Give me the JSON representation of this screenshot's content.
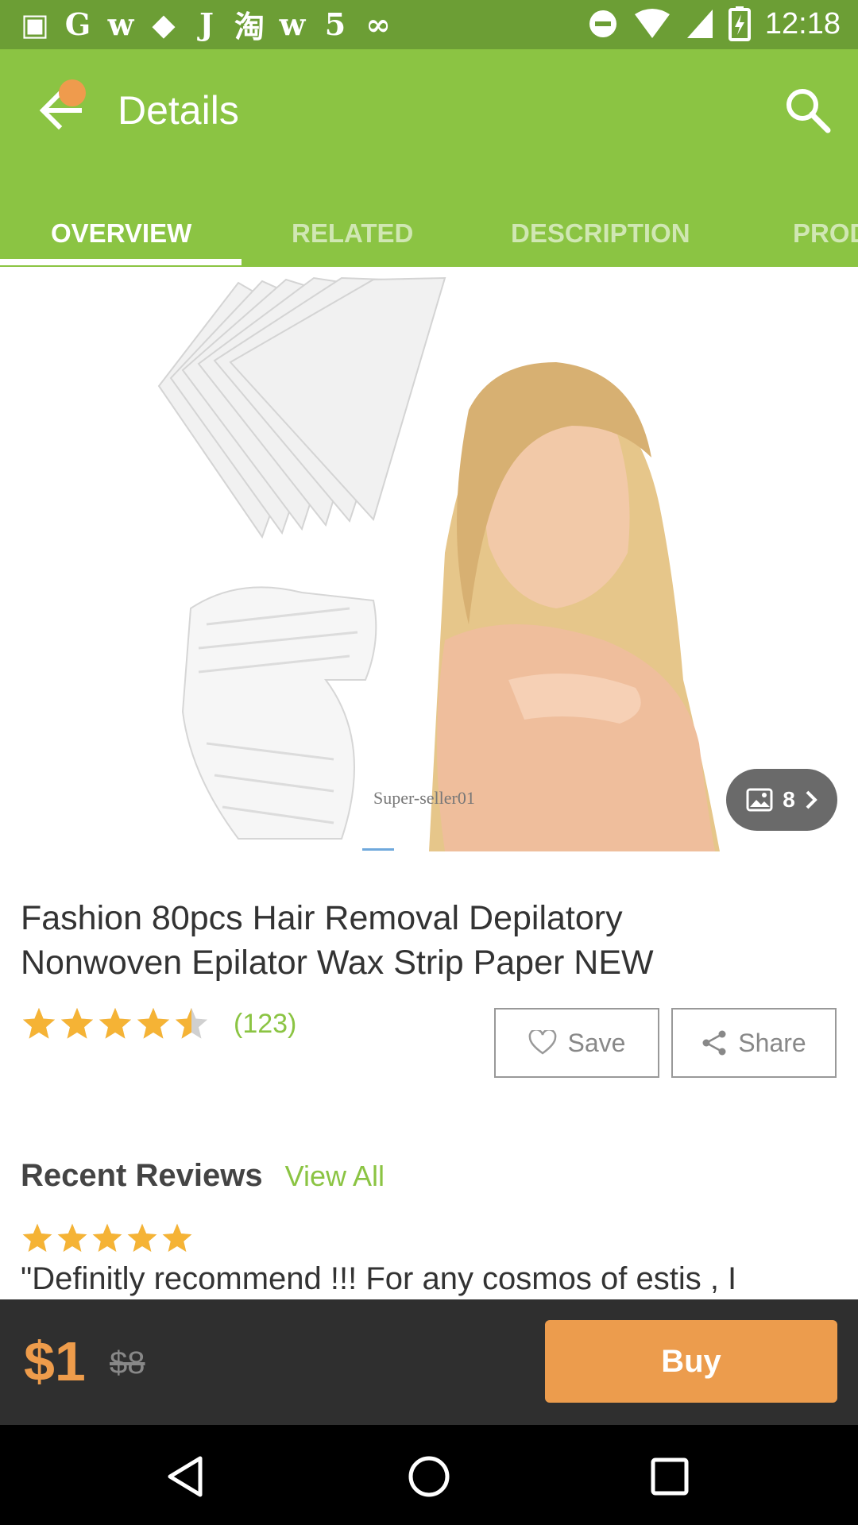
{
  "status_bar": {
    "notification_icons": [
      "shopping-bag-icon",
      "google-g-icon",
      "wish-icon",
      "gift-icon",
      "j-app-icon",
      "taobao-icon",
      "wish-icon",
      "tab-5-icon",
      "link-icon"
    ],
    "notification_glyphs": [
      "▣",
      "G",
      "w",
      "◆",
      "J",
      "淘",
      "w",
      "5",
      "∞"
    ],
    "time": "12:18"
  },
  "app_bar": {
    "title": "Details"
  },
  "tabs": [
    {
      "label": "OVERVIEW",
      "active": true
    },
    {
      "label": "RELATED",
      "active": false
    },
    {
      "label": "DESCRIPTION",
      "active": false
    },
    {
      "label": "PROD",
      "active": false
    }
  ],
  "hero": {
    "watermark": "Super-seller01",
    "gallery_count": "8"
  },
  "product": {
    "title_line1": "Fashion 80pcs Hair Removal Depilatory",
    "title_line2": "Nonwoven Epilator Wax Strip Paper NEW",
    "rating_value": 4.5,
    "rating_count": "(123)",
    "save_label": "Save",
    "share_label": "Share"
  },
  "reviews": {
    "title": "Recent Reviews",
    "view_all": "View All",
    "first_rating": 5,
    "first_text": "\"Definitly recommend !!! For any cosmos of estis , I"
  },
  "purchase": {
    "price": "$1",
    "old_price": "$8",
    "buy_label": "Buy"
  },
  "colors": {
    "primary_green": "#8bc443",
    "status_green": "#6c9e35",
    "accent_orange": "#ec9c4d",
    "star_gold": "#f5b335",
    "buy_bar": "#2f2f2f"
  }
}
